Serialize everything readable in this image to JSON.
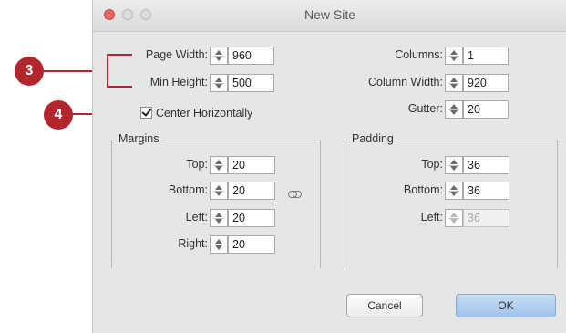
{
  "window": {
    "title": "New Site"
  },
  "callouts": {
    "c3": "3",
    "c4": "4"
  },
  "left_fields": {
    "page_width": {
      "label": "Page Width:",
      "value": "960"
    },
    "min_height": {
      "label": "Min Height:",
      "value": "500"
    },
    "center_horizontally": {
      "label": "Center Horizontally",
      "checked": true
    }
  },
  "right_fields": {
    "columns": {
      "label": "Columns:",
      "value": "1"
    },
    "column_width": {
      "label": "Column Width:",
      "value": "920"
    },
    "gutter": {
      "label": "Gutter:",
      "value": "20"
    }
  },
  "margins": {
    "title": "Margins",
    "top": {
      "label": "Top:",
      "value": "20"
    },
    "bottom": {
      "label": "Bottom:",
      "value": "20"
    },
    "left": {
      "label": "Left:",
      "value": "20"
    },
    "right": {
      "label": "Right:",
      "value": "20"
    }
  },
  "padding": {
    "title": "Padding",
    "top": {
      "label": "Top:",
      "value": "36"
    },
    "bottom": {
      "label": "Bottom:",
      "value": "36"
    },
    "left": {
      "label": "Left:",
      "value": "36",
      "disabled": true
    }
  },
  "buttons": {
    "cancel": "Cancel",
    "ok": "OK"
  },
  "colors": {
    "callout": "#b3262c",
    "ok_button": "#9ec4ec",
    "dialog_bg": "#e6e6e6"
  }
}
